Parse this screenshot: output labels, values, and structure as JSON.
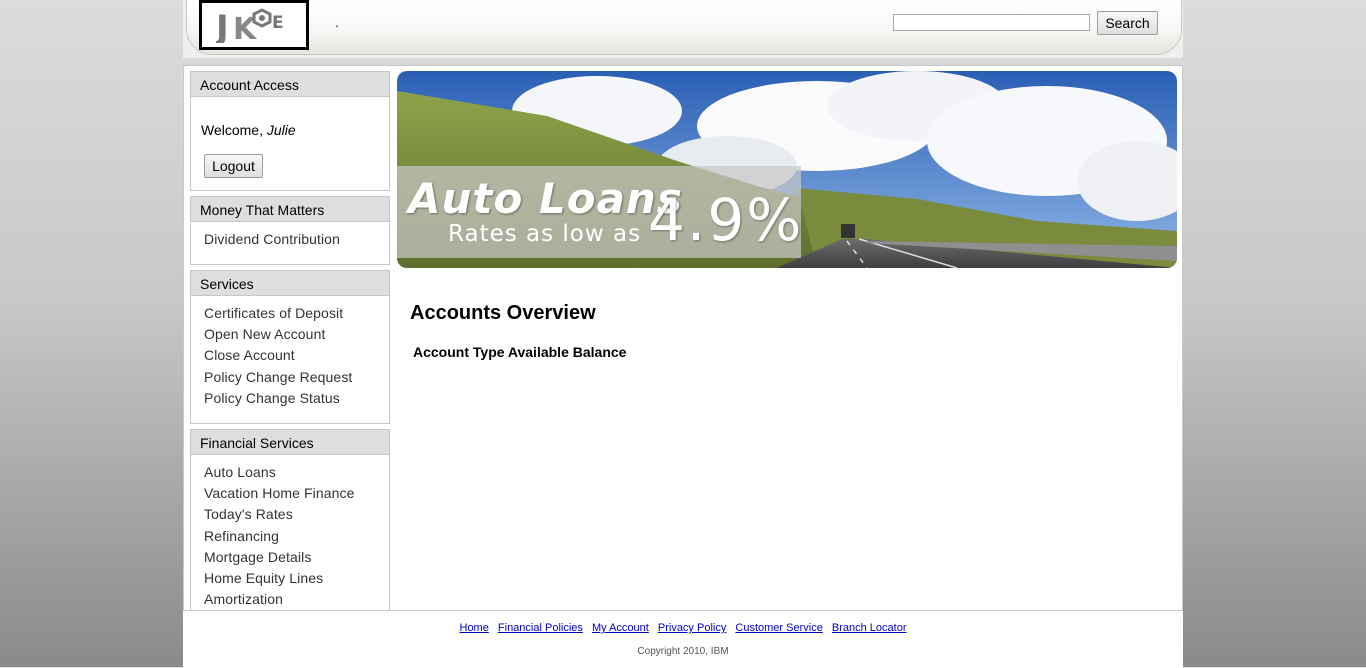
{
  "header": {
    "logo_text": "JKE",
    "separator": ".",
    "search": {
      "value": "",
      "placeholder": "",
      "button_label": "Search"
    }
  },
  "sidebar": {
    "account_access": {
      "title": "Account Access",
      "welcome_prefix": "Welcome,",
      "user_name": "Julie",
      "logout_label": "Logout"
    },
    "money_that_matters": {
      "title": "Money That Matters",
      "items": [
        "Dividend Contribution"
      ]
    },
    "services": {
      "title": "Services",
      "items": [
        "Certificates of Deposit",
        "Open New Account",
        "Close Account",
        "Policy Change Request",
        "Policy Change Status"
      ]
    },
    "financial_services": {
      "title": "Financial Services",
      "items": [
        "Auto Loans",
        "Vacation Home Finance",
        "Today's Rates",
        "Refinancing",
        "Mortgage Details",
        "Home Equity Lines",
        "Amortization"
      ]
    }
  },
  "banner": {
    "title": "Auto Loans",
    "subtitle": "Rates as low as",
    "rate": "4.9%"
  },
  "main": {
    "title": "Accounts Overview",
    "table_header": "Account Type Available Balance"
  },
  "footer": {
    "links": [
      "Home",
      "Financial Policies",
      "My Account",
      "Privacy Policy",
      "Customer Service",
      "Branch Locator"
    ],
    "copyright": "Copyright 2010, IBM"
  }
}
